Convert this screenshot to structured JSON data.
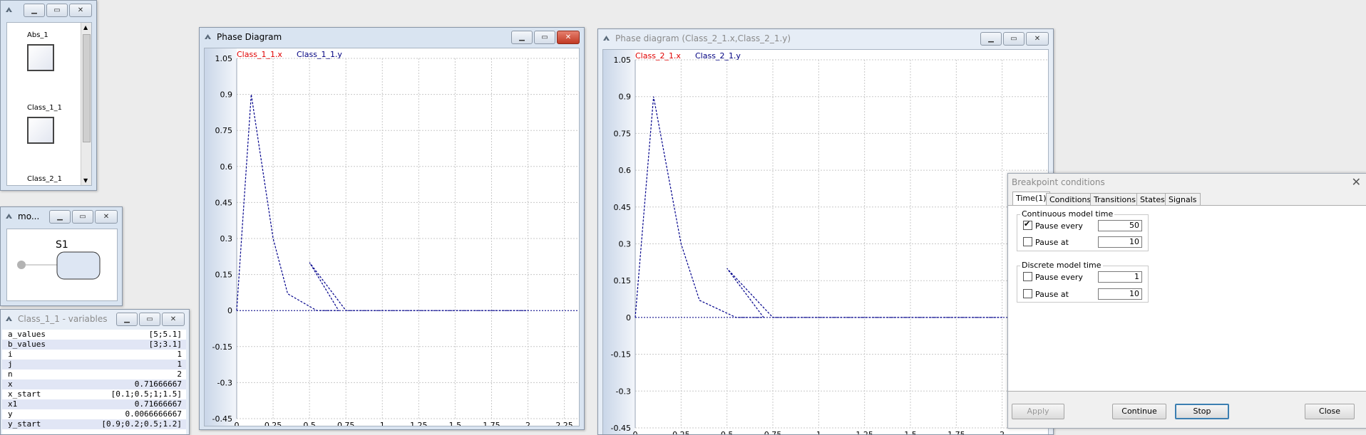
{
  "colors": {
    "x_series": "#e00000",
    "y_series": "#000080",
    "phase_line": "#00008b"
  },
  "palette": {
    "title": "",
    "items": [
      {
        "label": "Abs_1"
      },
      {
        "label": "Class_1_1"
      },
      {
        "label": "Class_2_1"
      }
    ]
  },
  "model_window": {
    "title": "mo...",
    "state_label": "S1"
  },
  "variables_window": {
    "title": "Class_1_1 - variables",
    "rows": [
      {
        "name": "a_values",
        "value": "[5;5.1]"
      },
      {
        "name": "b_values",
        "value": "[3;3.1]"
      },
      {
        "name": "i",
        "value": "1"
      },
      {
        "name": "j",
        "value": "1"
      },
      {
        "name": "n",
        "value": "2"
      },
      {
        "name": "x",
        "value": "0.71666667"
      },
      {
        "name": "x_start",
        "value": "[0.1;0.5;1;1.5]"
      },
      {
        "name": "x1",
        "value": "0.71666667"
      },
      {
        "name": "y",
        "value": "0.0066666667"
      },
      {
        "name": "y_start",
        "value": "[0.9;0.2;0.5;1.2]"
      }
    ]
  },
  "plot1": {
    "title": "Phase Diagram",
    "legend_x": "Class_1_1.x",
    "legend_y": "Class_1_1.y",
    "y_ticks": [
      "1.05",
      "0.9",
      "0.75",
      "0.6",
      "0.45",
      "0.3",
      "0.15",
      "0",
      "-0.15",
      "-0.3",
      "-0.45"
    ],
    "x_ticks": [
      "0",
      "0.25",
      "0.5",
      "0.75",
      "1",
      "1.25",
      "1.5",
      "1.75",
      "2",
      "2.25"
    ]
  },
  "plot2": {
    "title": "Phase diagram (Class_2_1.x,Class_2_1.y)",
    "legend_x": "Class_2_1.x",
    "legend_y": "Class_2_1.y",
    "y_ticks": [
      "1.05",
      "0.9",
      "0.75",
      "0.6",
      "0.45",
      "0.3",
      "0.15",
      "0",
      "-0.15",
      "-0.3",
      "-0.45"
    ],
    "x_ticks": [
      "0",
      "0.25",
      "0.5",
      "0.75",
      "1",
      "1.25",
      "1.5",
      "1.75",
      "2"
    ]
  },
  "chart_data": [
    {
      "type": "line",
      "xlim": [
        0,
        2.35
      ],
      "ylim": [
        -0.45,
        1.05
      ],
      "grid": true,
      "series": [
        {
          "name": "Class_1_1.y",
          "x": [
            0,
            0.1,
            0.25,
            0.35,
            0.55,
            0.7,
            0.5,
            0.75,
            2
          ],
          "y": [
            0,
            0.9,
            0.3,
            0.07,
            0,
            0,
            0.2,
            0,
            0
          ]
        }
      ]
    },
    {
      "type": "line",
      "xlim": [
        0,
        2.25
      ],
      "ylim": [
        -0.45,
        1.05
      ],
      "grid": true,
      "series": [
        {
          "name": "Class_2_1.y",
          "x": [
            0,
            0.1,
            0.25,
            0.35,
            0.55,
            0.7,
            0.5,
            0.75,
            2
          ],
          "y": [
            0,
            0.9,
            0.3,
            0.07,
            0,
            0,
            0.2,
            0,
            0
          ]
        }
      ]
    }
  ],
  "breakpoint": {
    "title": "Breakpoint conditions",
    "tabs": [
      "Time(1)",
      "Conditions",
      "Transitions",
      "States",
      "Signals"
    ],
    "continuous": {
      "label": "Continuous model time",
      "pause_every_label": "Pause every",
      "pause_every_value": "50",
      "pause_every_checked": true,
      "pause_at_label": "Pause at",
      "pause_at_value": "10",
      "pause_at_checked": false
    },
    "discrete": {
      "label": "Discrete model time",
      "pause_every_label": "Pause every",
      "pause_every_value": "1",
      "pause_every_checked": false,
      "pause_at_label": "Pause at",
      "pause_at_value": "10",
      "pause_at_checked": false
    },
    "buttons": {
      "apply": "Apply",
      "continue": "Continue",
      "stop": "Stop",
      "close": "Close"
    }
  }
}
